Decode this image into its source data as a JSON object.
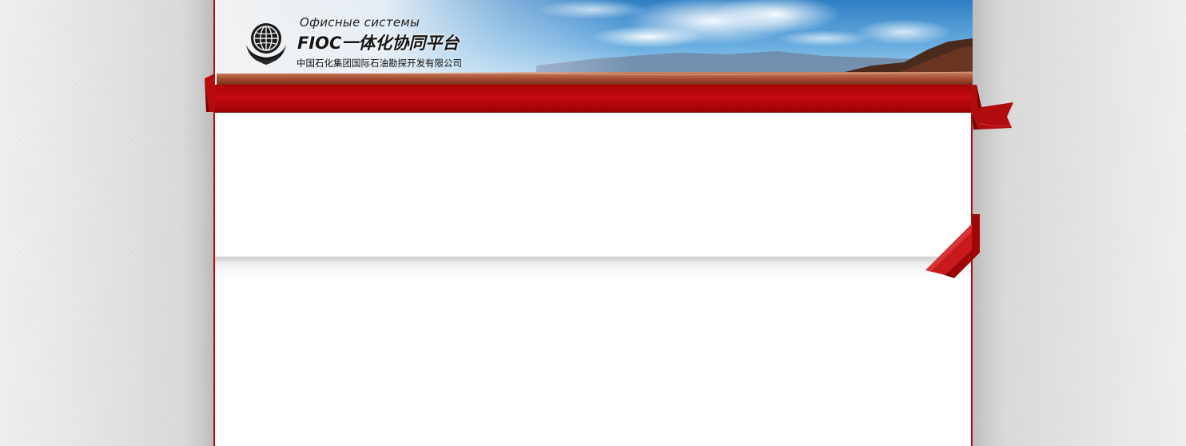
{
  "header": {
    "subtitle": "Офисные системы",
    "title": "FIOC一体化协同平台",
    "company": "中国石化集团国际石油勘探开发有限公司"
  },
  "colors": {
    "ribbon": "#b40d10",
    "frame_border": "#b40d10",
    "sky": "#3f8fd0",
    "ground": "#b4563a"
  },
  "icons": {
    "logo": "globe-phoenix-logo-icon"
  }
}
